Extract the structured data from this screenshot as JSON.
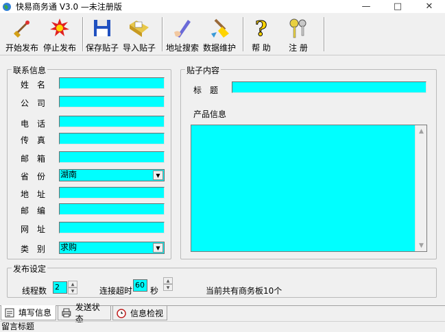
{
  "window": {
    "title": "快易商务通 V3.0 —未注册版"
  },
  "toolbar": {
    "start_publish": "开始发布",
    "stop_publish": "停止发布",
    "save_post": "保存贴子",
    "import_post": "导入贴子",
    "address_search": "地址搜索",
    "data_maintenance": "数据维护",
    "help": "帮  助",
    "register": "注  册"
  },
  "contact": {
    "title": "联系信息",
    "fields": {
      "name": "姓　名",
      "company": "公　司",
      "phone": "电　话",
      "fax": "传　真",
      "email": "邮　箱",
      "province": "省　份",
      "address": "地　址",
      "zipcode": "邮　编",
      "website": "网　址",
      "category": "类　别"
    },
    "province_value": "湖南",
    "category_value": "求购"
  },
  "post": {
    "title": "贴子内容",
    "subject_label": "标　题",
    "product_info_label": "产品信息"
  },
  "publish_settings": {
    "title": "发布设定",
    "threads_label": "线程数",
    "threads_value": "2",
    "timeout_label": "连接超时",
    "timeout_value": "60",
    "timeout_unit": "秒",
    "board_count_text": "当前共有商务板10个"
  },
  "tabs": [
    "填写信息",
    "发送状态",
    "信息检视"
  ],
  "status": {
    "text": "留言标题"
  },
  "colors": {
    "field_bg": "#00ffff",
    "window_bg": "#f0f0f0"
  }
}
